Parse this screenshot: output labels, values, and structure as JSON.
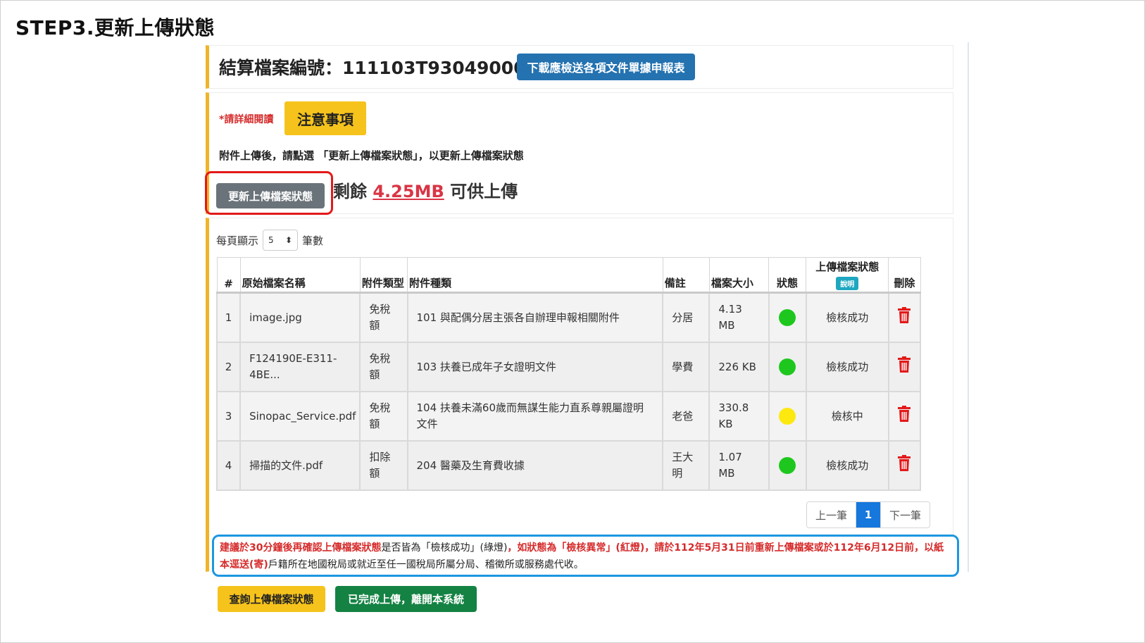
{
  "step_title": "STEP3.更新上傳狀態",
  "file_number": "結算檔案編號：111103T9304900001",
  "download_button": "下載應檢送各項文件單據申報表",
  "read_note": "*請詳細閱讀",
  "notice_button": "注意事項",
  "instruction": "附件上傳後，請點選 「更新上傳檔案狀態」，以更新上傳檔案狀態",
  "refresh_button": "更新上傳檔案狀態",
  "remaining": {
    "prefix": "剩餘 ",
    "size": "4.25MB",
    "suffix": " 可供上傳"
  },
  "per_page": {
    "label_before": "每頁顯示",
    "value": "5",
    "label_after": "筆數"
  },
  "table": {
    "headers": [
      "#",
      "原始檔案名稱",
      "附件類型",
      "附件種類",
      "備註",
      "檔案大小",
      "狀態",
      "上傳檔案狀態",
      "刪除"
    ],
    "explain_badge": "說明",
    "rows": [
      {
        "num": "1",
        "name": "image.jpg",
        "type": "免稅額",
        "category": "101 與配偶分居主張各自辦理申報相關附件",
        "note": "分居",
        "size": "4.13 MB",
        "status_color": "#1ec71e",
        "upload_status": "檢核成功"
      },
      {
        "num": "2",
        "name": "F124190E-E311-4BE...",
        "type": "免稅額",
        "category": "103 扶養已成年子女證明文件",
        "note": "學費",
        "size": "226 KB",
        "status_color": "#1ec71e",
        "upload_status": "檢核成功"
      },
      {
        "num": "3",
        "name": "Sinopac_Service.pdf",
        "type": "免稅額",
        "category": "104 扶養未滿60歲而無謀生能力直系尊親屬證明文件",
        "note": "老爸",
        "size": "330.8 KB",
        "status_color": "#fde80f",
        "upload_status": "檢核中"
      },
      {
        "num": "4",
        "name": "掃描的文件.pdf",
        "type": "扣除額",
        "category": "204 醫藥及生育費收據",
        "note": "王大明",
        "size": "1.07 MB",
        "status_color": "#1ec71e",
        "upload_status": "檢核成功"
      }
    ]
  },
  "pagination": {
    "prev": "上一筆",
    "current": "1",
    "next": "下一筆"
  },
  "advice": {
    "part1": "建議於30分鐘後再確認上傳檔案狀態",
    "part2": "是否皆為「檢核成功」(綠燈)",
    "part3": "，如狀態為「檢核異常」(紅燈)，請於112年5月31日前重新上傳檔案或於112年6月12日前，以紙本逕送(寄)",
    "part4": "戶籍所在地國稅局或就近至任一國稅局所屬分局、稽徵所或服務處代收。"
  },
  "query_button": "查詢上傳檔案狀態",
  "done_button": "已完成上傳，離開本系統",
  "colors": {
    "accent_yellow": "#f6c31c",
    "primary_blue": "#2472b0",
    "success_green": "#148243",
    "danger_red": "#e3191a",
    "highlight_blue": "#1d97e0"
  }
}
